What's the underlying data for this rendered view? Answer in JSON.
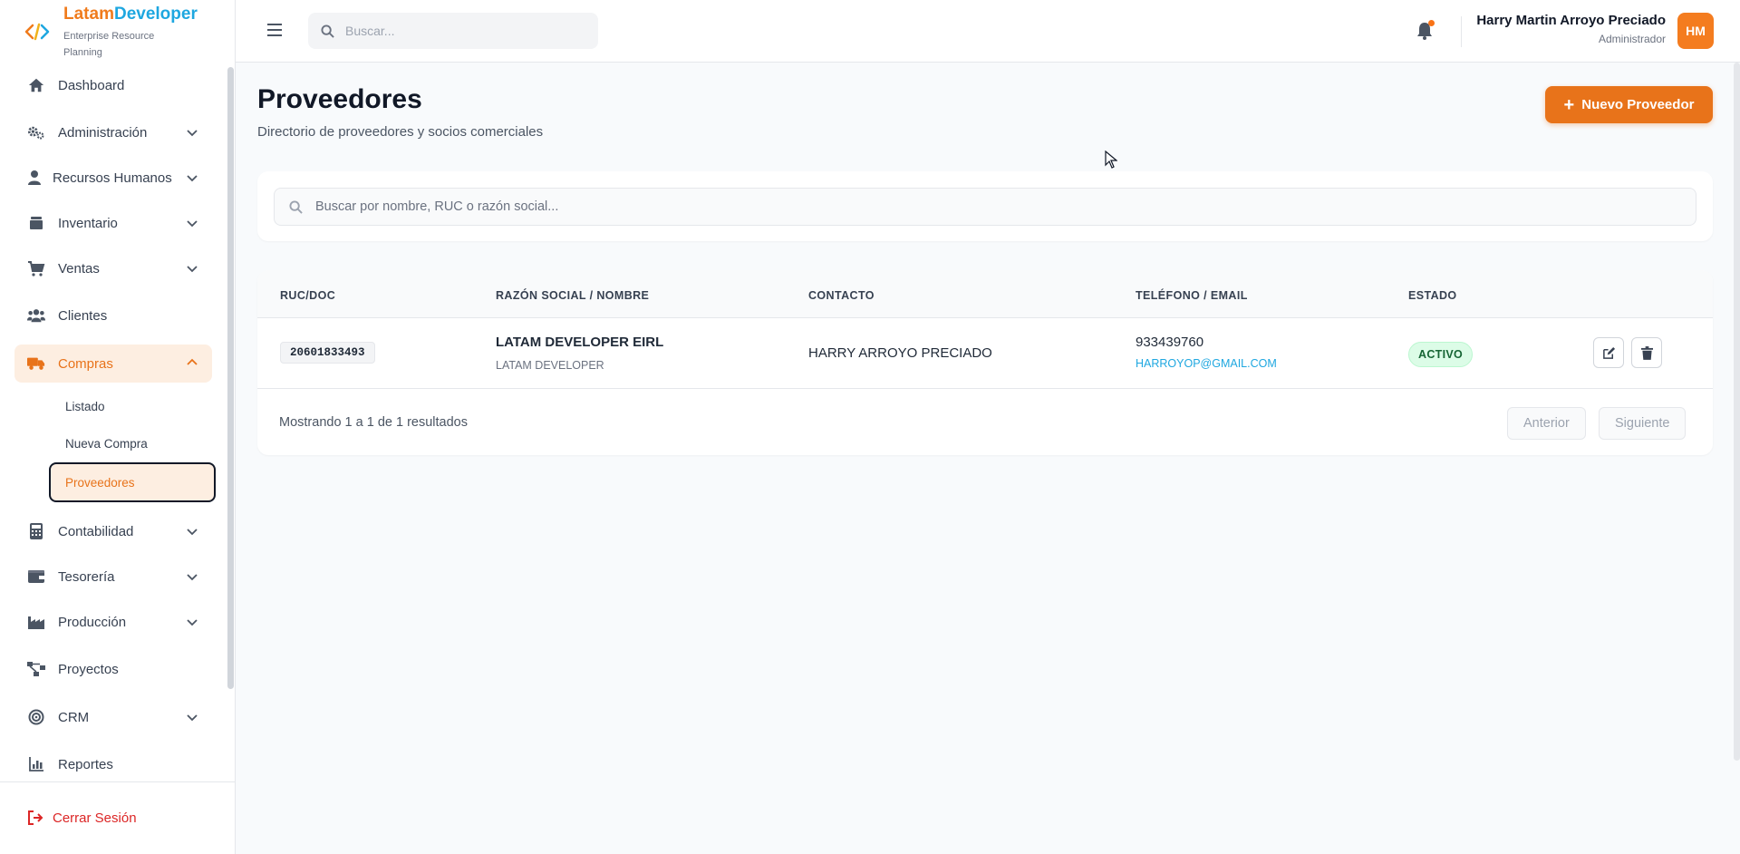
{
  "brand": {
    "name_part1": "Latam",
    "name_part2": "Developer",
    "subtitle": "Enterprise Resource Planning"
  },
  "sidebar": {
    "items": [
      {
        "label": "Dashboard",
        "icon": "home-icon"
      },
      {
        "label": "Administración",
        "icon": "gears-icon"
      },
      {
        "label": "Recursos Humanos",
        "icon": "user-icon"
      },
      {
        "label": "Inventario",
        "icon": "box-icon"
      },
      {
        "label": "Ventas",
        "icon": "cart-icon"
      },
      {
        "label": "Clientes",
        "icon": "users-icon"
      },
      {
        "label": "Compras",
        "icon": "truck-icon"
      },
      {
        "label": "Contabilidad",
        "icon": "calculator-icon"
      },
      {
        "label": "Tesorería",
        "icon": "wallet-icon"
      },
      {
        "label": "Producción",
        "icon": "factory-icon"
      },
      {
        "label": "Proyectos",
        "icon": "project-diagram-icon"
      },
      {
        "label": "CRM",
        "icon": "target-icon"
      },
      {
        "label": "Reportes",
        "icon": "chart-bar-icon"
      }
    ],
    "compras_sub": [
      {
        "label": "Listado"
      },
      {
        "label": "Nueva Compra"
      },
      {
        "label": "Proveedores"
      }
    ],
    "logout": "Cerrar Sesión"
  },
  "topbar": {
    "search_placeholder": "Buscar...",
    "user_name": "Harry Martin Arroyo Preciado",
    "user_role": "Administrador",
    "avatar_initials": "HM"
  },
  "page": {
    "title": "Proveedores",
    "subtitle": "Directorio de proveedores y socios comerciales",
    "new_button": "Nuevo Proveedor",
    "filter_placeholder": "Buscar por nombre, RUC o razón social..."
  },
  "table": {
    "headers": [
      "RUC/DOC",
      "RAZÓN SOCIAL / NOMBRE",
      "CONTACTO",
      "TELÉFONO / EMAIL",
      "ESTADO"
    ],
    "rows": [
      {
        "ruc": "20601833493",
        "name": "LATAM DEVELOPER EIRL",
        "trade_name": "LATAM DEVELOPER",
        "contact": "HARRY ARROYO PRECIADO",
        "phone": "933439760",
        "email": "HARROYOP@GMAIL.COM",
        "status": "ACTIVO"
      }
    ],
    "pagination_text": "Mostrando 1 a 1 de 1 resultados",
    "prev_label": "Anterior",
    "next_label": "Siguiente"
  },
  "colors": {
    "accent": "#e8731a",
    "brand_blue": "#1ea7e0",
    "danger": "#dc2626",
    "success": "#166534"
  }
}
